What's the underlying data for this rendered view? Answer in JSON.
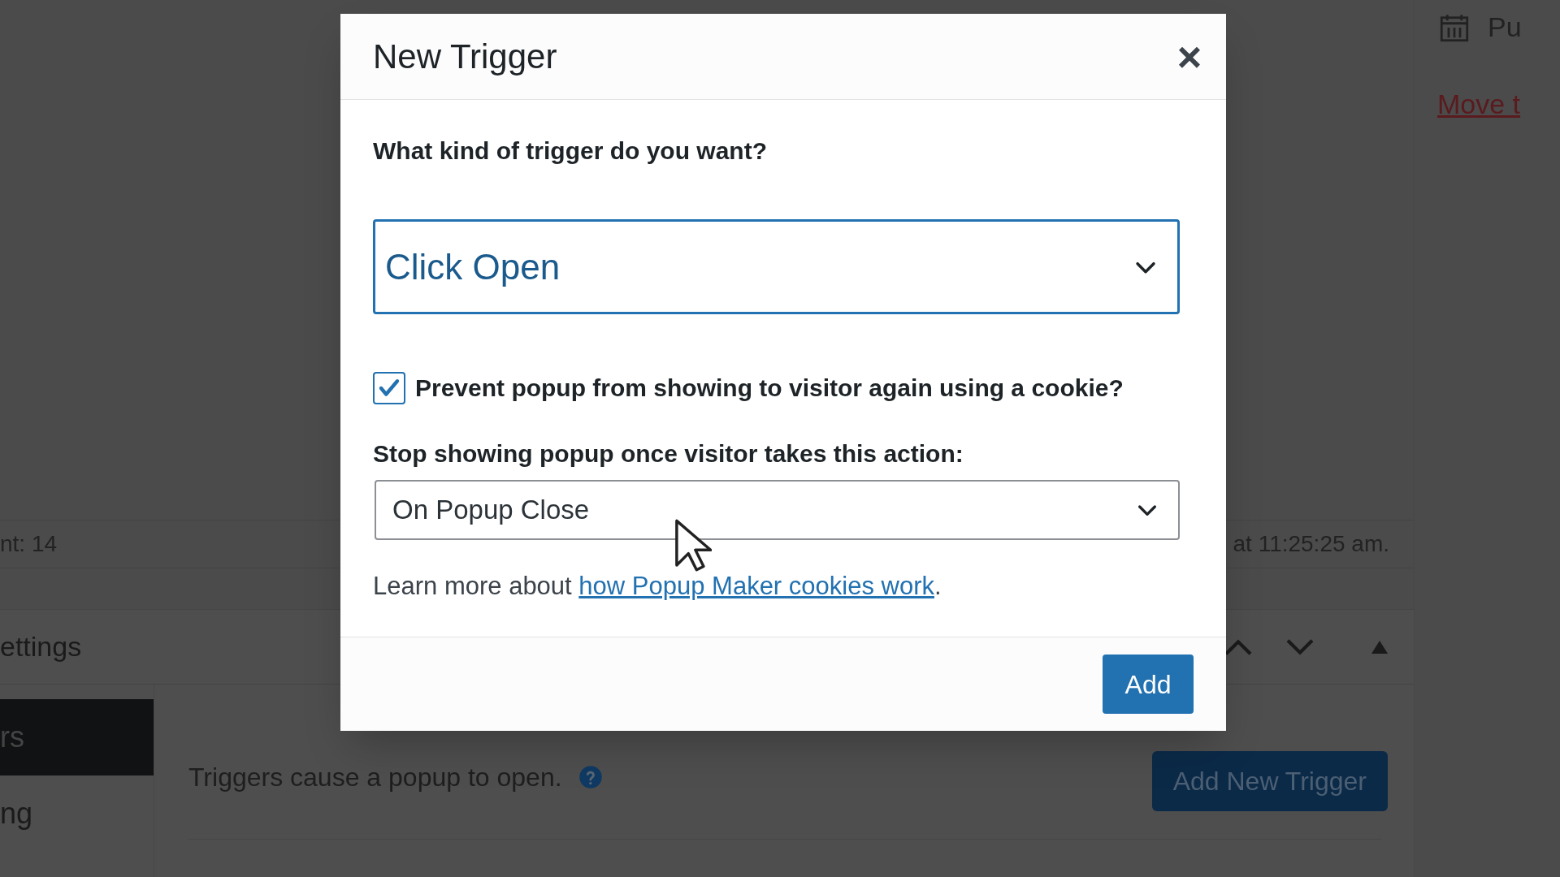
{
  "background": {
    "sidebar": {
      "status_text": "Pu",
      "link": "Move t"
    },
    "info_row": {
      "left": "nt: 14",
      "right": "at 11:25:25 am."
    },
    "settings_panel": {
      "title": "ettings",
      "tabs": [
        {
          "label": "rs",
          "selected": true
        },
        {
          "label": "ng",
          "selected": false
        }
      ],
      "description": "Triggers cause a popup to open.",
      "add_button": "Add New Trigger"
    }
  },
  "modal": {
    "title": "New Trigger",
    "close": "×",
    "question": "What kind of trigger do you want?",
    "trigger_select": {
      "value": "Click Open"
    },
    "cookie_checkbox": {
      "label": "Prevent popup from showing to visitor again using a cookie?",
      "checked": true
    },
    "action_label": "Stop showing popup once visitor takes this action:",
    "action_select": {
      "value": "On Popup Close"
    },
    "learn_more": {
      "text": "Learn more about ",
      "link": "how Popup Maker cookies work",
      "after": "."
    },
    "button": "Add"
  }
}
